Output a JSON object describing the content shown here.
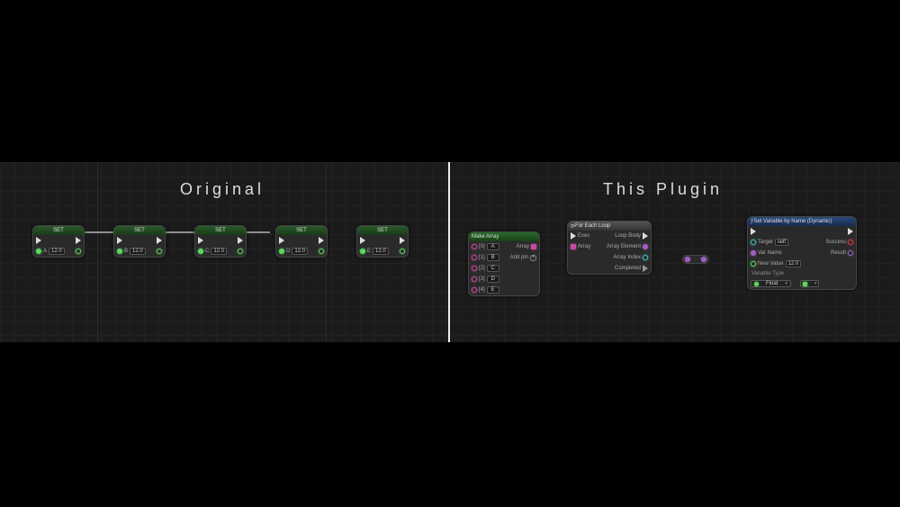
{
  "headings": {
    "original": "Original",
    "plugin": "This Plugin"
  },
  "set_nodes": {
    "title": "SET",
    "value": "12.0",
    "vars": [
      "A",
      "B",
      "C",
      "D",
      "E"
    ]
  },
  "make_array": {
    "title": "Make Array",
    "items": [
      "A",
      "B",
      "C",
      "D",
      "E"
    ],
    "index_labels": [
      "[0]",
      "[1]",
      "[2]",
      "[3]",
      "[4]"
    ],
    "out_label": "Array",
    "add_pin": "Add pin"
  },
  "foreach": {
    "title": "For Each Loop",
    "exec_in": "Exec",
    "array_in": "Array",
    "loop_body": "Loop Body",
    "element": "Array Element",
    "index": "Array Index",
    "completed": "Completed"
  },
  "setvar": {
    "title": "Set Variable by Name (Dynamic)",
    "target": "Target",
    "target_value": "self",
    "varname": "Var Name",
    "newvalue": "New Value",
    "newvalue_val": "12.0",
    "success": "Success",
    "result": "Result",
    "section": "Variable Type",
    "type_value": "Float"
  }
}
